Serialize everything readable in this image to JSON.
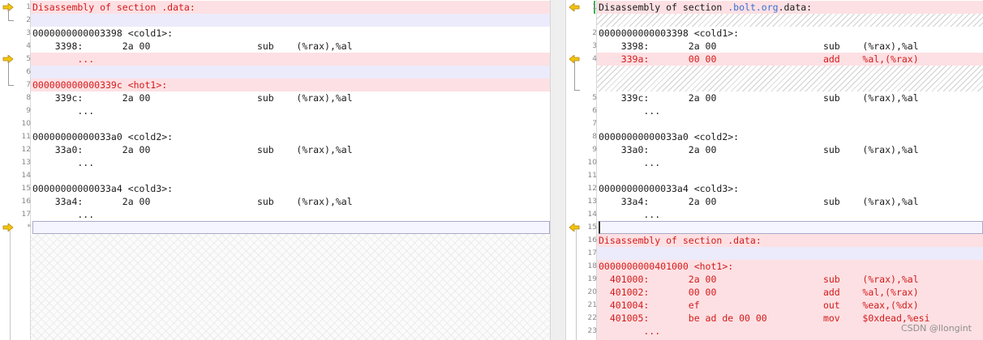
{
  "watermark": "CSDN @llongint",
  "colors": {
    "diff_text": "#d31a1a",
    "diff_bg": "#fde0e3",
    "gap_bg": "#ecebfb",
    "accent": "#3b6fd4",
    "arrow": "#f1c40f"
  },
  "left": {
    "lines": [
      {
        "n": "1",
        "t": "Disassembly of section .data:",
        "d": true
      },
      {
        "n": "2",
        "t": "",
        "d": false
      },
      {
        "n": "3",
        "t": "0000000000003398 <cold1>:",
        "d": false
      },
      {
        "n": "4",
        "t": "    3398:       2a 00                   sub    (%rax),%al",
        "d": false
      },
      {
        "n": "5",
        "t": "        ...",
        "d": true
      },
      {
        "n": "6",
        "t": "",
        "d": false
      },
      {
        "n": "7",
        "t": "000000000000339c <hot1>:",
        "d": true
      },
      {
        "n": "8",
        "t": "    339c:       2a 00                   sub    (%rax),%al",
        "d": false
      },
      {
        "n": "9",
        "t": "        ...",
        "d": false
      },
      {
        "n": "10",
        "t": "",
        "d": false
      },
      {
        "n": "11",
        "t": "00000000000033a0 <cold2>:",
        "d": false
      },
      {
        "n": "12",
        "t": "    33a0:       2a 00                   sub    (%rax),%al",
        "d": false
      },
      {
        "n": "13",
        "t": "        ...",
        "d": false
      },
      {
        "n": "14",
        "t": "",
        "d": false
      },
      {
        "n": "15",
        "t": "00000000000033a4 <cold3>:",
        "d": false
      },
      {
        "n": "16",
        "t": "    33a4:       2a 00                   sub    (%rax),%al",
        "d": false
      },
      {
        "n": "17",
        "t": "        ...",
        "d": false
      },
      {
        "n": "*",
        "t": "",
        "d": false
      }
    ]
  },
  "right": {
    "title_pre": "Disassembly of section ",
    "title_hl": ".bolt.org",
    "title_post": ".data:",
    "lines": [
      {
        "n": "1",
        "t": "",
        "d": true
      },
      {
        "n": "2",
        "t": "0000000000003398 <cold1>:",
        "d": false
      },
      {
        "n": "3",
        "t": "    3398:       2a 00                   sub    (%rax),%al",
        "d": false
      },
      {
        "n": "4",
        "t": "    339a:       00 00                   add    %al,(%rax)",
        "d": true
      },
      {
        "n": "5",
        "t": "    339c:       2a 00                   sub    (%rax),%al",
        "d": false
      },
      {
        "n": "6",
        "t": "        ...",
        "d": false
      },
      {
        "n": "7",
        "t": "",
        "d": false
      },
      {
        "n": "8",
        "t": "00000000000033a0 <cold2>:",
        "d": false
      },
      {
        "n": "9",
        "t": "    33a0:       2a 00                   sub    (%rax),%al",
        "d": false
      },
      {
        "n": "10",
        "t": "        ...",
        "d": false
      },
      {
        "n": "11",
        "t": "",
        "d": false
      },
      {
        "n": "12",
        "t": "00000000000033a4 <cold3>:",
        "d": false
      },
      {
        "n": "13",
        "t": "    33a4:       2a 00                   sub    (%rax),%al",
        "d": false
      },
      {
        "n": "14",
        "t": "        ...",
        "d": false
      },
      {
        "n": "15",
        "t": "",
        "d": false
      },
      {
        "n": "16",
        "t": "Disassembly of section .data:",
        "d": true
      },
      {
        "n": "17",
        "t": "",
        "d": true
      },
      {
        "n": "18",
        "t": "0000000000401000 <hot1>:",
        "d": true
      },
      {
        "n": "19",
        "t": "  401000:       2a 00                   sub    (%rax),%al",
        "d": true
      },
      {
        "n": "20",
        "t": "  401002:       00 00                   add    %al,(%rax)",
        "d": true
      },
      {
        "n": "21",
        "t": "  401004:       ef                      out    %eax,(%dx)",
        "d": true
      },
      {
        "n": "22",
        "t": "  401005:       be ad de 00 00          mov    $0xdead,%esi",
        "d": true
      },
      {
        "n": "23",
        "t": "        ...",
        "d": true
      }
    ]
  }
}
